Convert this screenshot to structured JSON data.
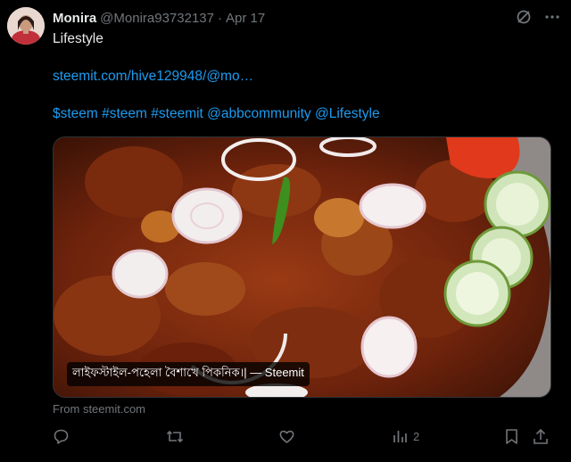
{
  "tweet": {
    "display_name": "Monira",
    "handle": "@Monira93732137",
    "separator": "·",
    "date": "Apr 17",
    "lines": [
      "Lifestyle",
      "",
      "steemit.com/hive129948/@mo…",
      "",
      "$steem #steem #steemit @abbcommunity @Lifestyle"
    ]
  },
  "media": {
    "caption": "লাইফস্টাইল-পহেলা বৈশাখে পিকনিক।| — Steemit"
  },
  "source_text": "From steemit.com",
  "actions": {
    "views_count": "2"
  },
  "colors": {
    "background": "#000000",
    "text": "#e7e9ea",
    "muted": "#71767b",
    "link": "#1d9bf0"
  },
  "icons": [
    "grok-icon",
    "more-icon",
    "reply-icon",
    "retweet-icon",
    "like-icon",
    "views-icon",
    "bookmark-icon",
    "share-icon"
  ]
}
